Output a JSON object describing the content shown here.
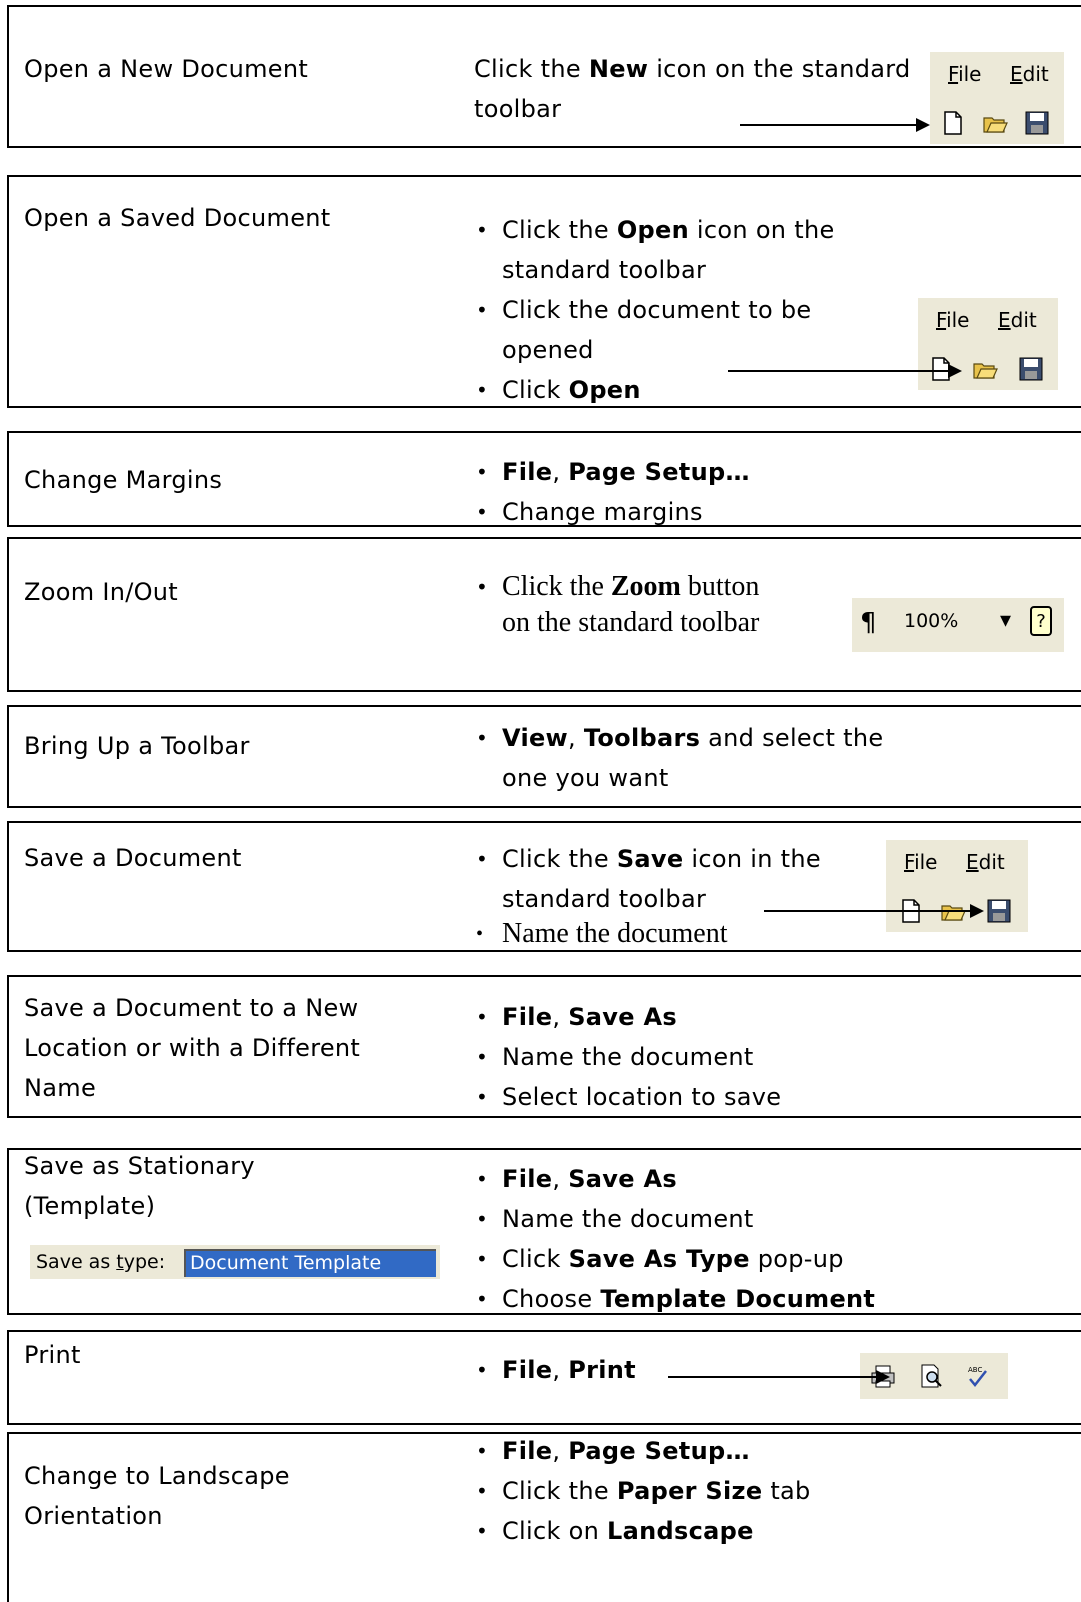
{
  "rows": [
    {
      "task": "Open a New Document",
      "desc": {
        "pre": "Click the ",
        "bold": "New",
        "post": " icon on the standard toolbar"
      }
    },
    {
      "task": "Open a Saved Document",
      "bullets": [
        {
          "pre": "Click the ",
          "bold": "Open",
          "post": " icon on the standard toolbar"
        },
        {
          "pre": "Click the document to be opened",
          "bold": "",
          "post": ""
        },
        {
          "pre": "Click ",
          "bold": "Open",
          "post": ""
        }
      ]
    },
    {
      "task": "Change Margins",
      "bullets": [
        {
          "b1": "File",
          "sep": ", ",
          "b2": "Page Setup…"
        },
        {
          "text": "Change margins"
        }
      ]
    },
    {
      "task": "Zoom In/Out",
      "bullets": [
        {
          "pre": "Click the ",
          "bold": "Zoom",
          "post": " button on the standard toolbar"
        }
      ]
    },
    {
      "task": "Bring Up a Toolbar",
      "bullets": [
        {
          "b1": "View",
          "sep": ", ",
          "b2": "Toolbars",
          "post": " and select the one you want"
        }
      ]
    },
    {
      "task": "Save a Document",
      "bullets": [
        {
          "pre": "Click the ",
          "bold": "Save",
          "post": " icon in the standard toolbar"
        },
        {
          "text": "Name the document"
        }
      ]
    },
    {
      "task": "Save a Document to a New Location or with a Different Name",
      "bullets": [
        {
          "b1": "File",
          "sep": ", ",
          "b2": "Save As"
        },
        {
          "text": "Name the document"
        },
        {
          "text": "Select location to save"
        }
      ]
    },
    {
      "task": "Save as Stationary (Template)",
      "bullets": [
        {
          "b1": "File",
          "sep": ", ",
          "b2": "Save As"
        },
        {
          "text": "Name the document"
        },
        {
          "pre": "Click ",
          "bold": "Save As Type",
          "post": " pop-up"
        },
        {
          "pre": "Choose ",
          "bold": "Template Document",
          "post": ""
        }
      ]
    },
    {
      "task": "Print",
      "bullets": [
        {
          "b1": "File",
          "sep": ", ",
          "b2": "Print"
        }
      ]
    },
    {
      "task": "Change to Landscape Orientation",
      "bullets": [
        {
          "b1": "File",
          "sep": ", ",
          "b2": "Page Setup…"
        },
        {
          "pre": "Click the ",
          "bold": "Paper Size",
          "post": " tab"
        },
        {
          "pre": "Click on ",
          "bold": "Landscape",
          "post": ""
        }
      ]
    }
  ],
  "menu": {
    "file": "File",
    "file_u": "F",
    "file_rest": "ile",
    "edit": "Edit",
    "edit_u": "E",
    "edit_rest": "dit"
  },
  "zoom": {
    "pilcrow": "¶",
    "value": "100%",
    "arrow": "▾",
    "help": "?"
  },
  "savetype": {
    "label_pre": "Save as ",
    "label_u": "t",
    "label_post": "ype:",
    "value": "Document Template"
  },
  "colors": {
    "toolbar_bg": "#ece9d8",
    "highlight": "#316ac5"
  }
}
